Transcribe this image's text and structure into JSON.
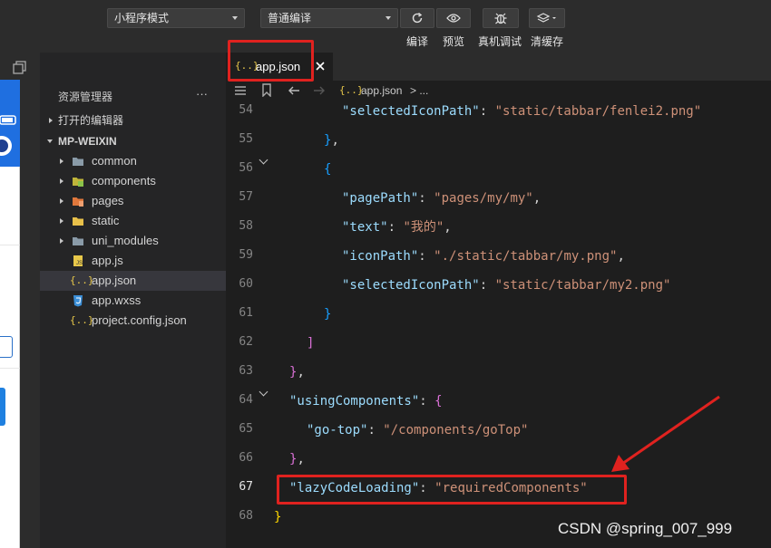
{
  "toolbar": {
    "mode_select": "小程序模式",
    "compile_select": "普通编译",
    "compile_label": "编译",
    "preview_label": "预览",
    "device_debug_label": "真机调试",
    "clear_cache_label": "清缓存"
  },
  "explorer": {
    "title": "资源管理器",
    "more": "···",
    "open_editors": "打开的编辑器",
    "project": "MP-WEIXIN",
    "items": [
      {
        "label": "common",
        "type": "folder"
      },
      {
        "label": "components",
        "type": "folder"
      },
      {
        "label": "pages",
        "type": "folder"
      },
      {
        "label": "static",
        "type": "folder"
      },
      {
        "label": "uni_modules",
        "type": "folder"
      },
      {
        "label": "app.js",
        "type": "js"
      },
      {
        "label": "app.json",
        "type": "json"
      },
      {
        "label": "app.wxss",
        "type": "css"
      },
      {
        "label": "project.config.json",
        "type": "json"
      }
    ]
  },
  "editor": {
    "tab_label": "app.json",
    "tab_icon": "{..}",
    "breadcrumb_file": "app.json",
    "breadcrumb_rest": "> ...",
    "line_numbers": [
      "54",
      "55",
      "56",
      "57",
      "58",
      "59",
      "60",
      "61",
      "62",
      "63",
      "64",
      "65",
      "66",
      "67",
      "68"
    ],
    "lines": {
      "l54_key": "\"selectedIconPath\"",
      "l54_val": "\"static/tabbar/fenlei2.png\"",
      "l57_key": "\"pagePath\"",
      "l57_val": "\"pages/my/my\"",
      "l58_key": "\"text\"",
      "l58_val": "\"我的\"",
      "l59_key": "\"iconPath\"",
      "l59_val": "\"./static/tabbar/my.png\"",
      "l60_key": "\"selectedIconPath\"",
      "l60_val": "\"static/tabbar/my2.png\"",
      "l64_key": "\"usingComponents\"",
      "l65_key": "\"go-top\"",
      "l65_val": "\"/components/goTop\"",
      "l67_key": "\"lazyCodeLoading\"",
      "l67_val": "\"requiredComponents\""
    }
  },
  "watermark": "CSDN @spring_007_999",
  "colors": {
    "annotation": "#e0221f",
    "accent": "#1f6fe0"
  }
}
